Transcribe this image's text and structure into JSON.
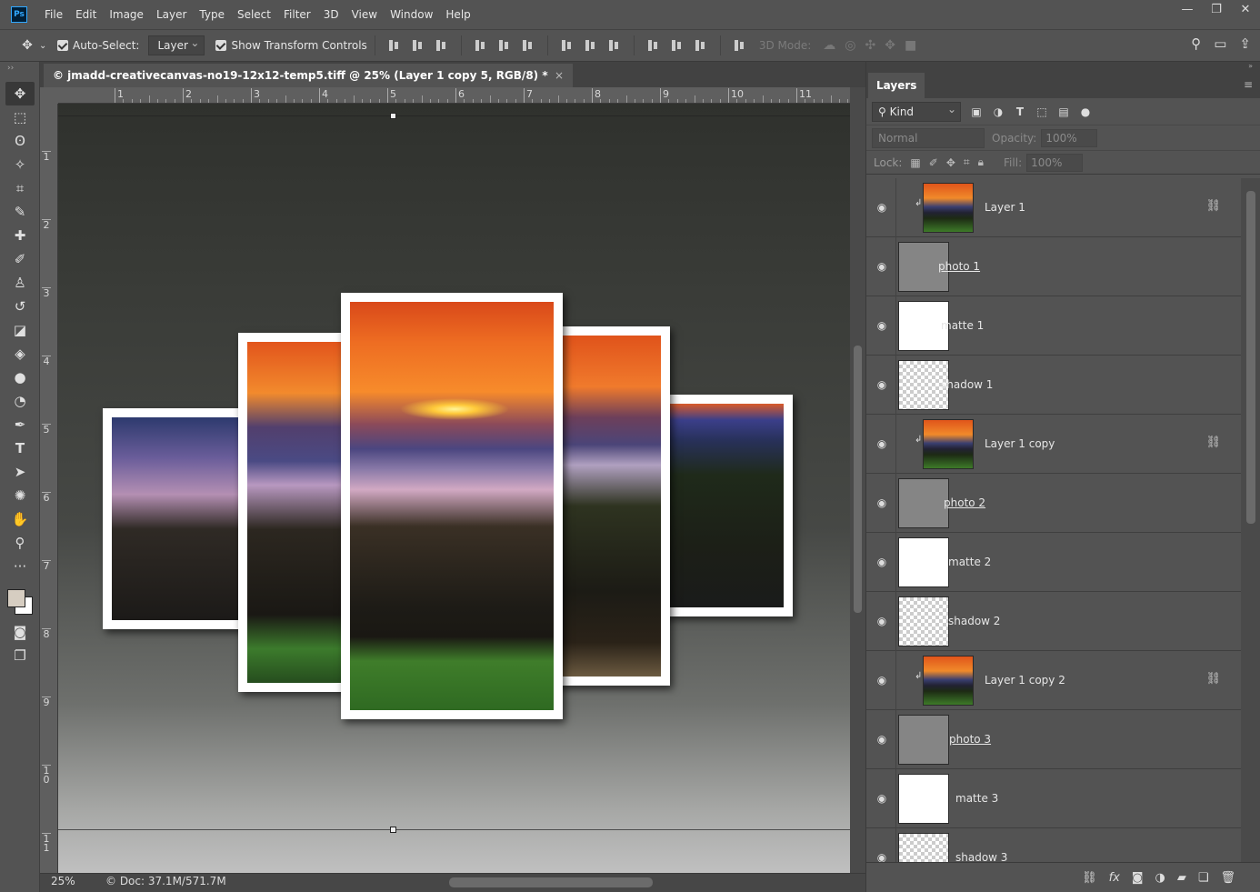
{
  "app": {
    "logo": "Ps",
    "menu": [
      "File",
      "Edit",
      "Image",
      "Layer",
      "Type",
      "Select",
      "Filter",
      "3D",
      "View",
      "Window",
      "Help"
    ],
    "window_controls": {
      "minimize": "—",
      "restore": "❐",
      "close": "✕"
    }
  },
  "options": {
    "auto_select_label": "Auto-Select:",
    "auto_select_value": "Layer",
    "show_transform_label": "Show Transform Controls",
    "mode_3d_label": "3D Mode:"
  },
  "document": {
    "tab_title": "© jmadd-creativecanvas-no19-12x12-temp5.tiff @ 25% (Layer 1 copy 5, RGB/8) *",
    "close": "×",
    "zoom": "25%",
    "doc_info": "© Doc: 37.1M/571.7M"
  },
  "rulers": {
    "top": [
      "1",
      "2",
      "3",
      "4",
      "5",
      "6",
      "7",
      "8",
      "9",
      "10",
      "11"
    ],
    "left": [
      "1",
      "2",
      "3",
      "4",
      "5",
      "6",
      "7",
      "8",
      "9",
      "1\n0",
      "1\n1"
    ]
  },
  "layers_panel": {
    "tab": "Layers",
    "kind_label": "Kind",
    "blend_mode": "Normal",
    "opacity_label": "Opacity:",
    "opacity_value": "100%",
    "lock_label": "Lock:",
    "fill_label": "Fill:",
    "fill_value": "100%",
    "layers": [
      {
        "name": "Layer 1",
        "thumb": "photo",
        "clipped": true,
        "linked": true,
        "underline": false
      },
      {
        "name": "photo 1",
        "thumb": "gray",
        "clipped": false,
        "linked": false,
        "underline": true
      },
      {
        "name": "matte 1",
        "thumb": "white",
        "clipped": false,
        "linked": false,
        "underline": false
      },
      {
        "name": "shadow 1",
        "thumb": "checker",
        "clipped": false,
        "linked": false,
        "underline": false
      },
      {
        "name": "Layer 1 copy",
        "thumb": "photo",
        "clipped": true,
        "linked": true,
        "underline": false
      },
      {
        "name": "photo 2",
        "thumb": "gray",
        "clipped": false,
        "linked": false,
        "underline": true
      },
      {
        "name": "matte 2",
        "thumb": "white",
        "clipped": false,
        "linked": false,
        "underline": false
      },
      {
        "name": "shadow 2",
        "thumb": "checker",
        "clipped": false,
        "linked": false,
        "underline": false
      },
      {
        "name": "Layer 1 copy 2",
        "thumb": "photo",
        "clipped": true,
        "linked": true,
        "underline": false
      },
      {
        "name": "photo 3",
        "thumb": "gray",
        "clipped": false,
        "linked": false,
        "underline": true
      },
      {
        "name": "matte 3",
        "thumb": "white",
        "clipped": false,
        "linked": false,
        "underline": false
      },
      {
        "name": "shadow 3",
        "thumb": "checker",
        "clipped": false,
        "linked": false,
        "underline": false
      }
    ]
  },
  "colors": {
    "foreground": "#d6cdc1",
    "background": "#ffffff",
    "ui_bg": "#535353",
    "accent": "#31a8ff"
  }
}
